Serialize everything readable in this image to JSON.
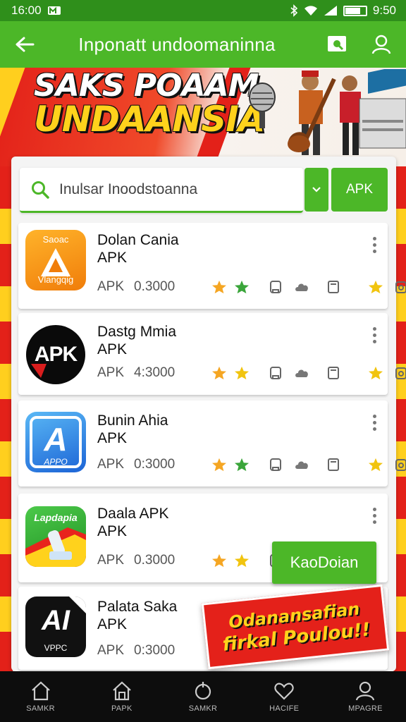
{
  "status_bar": {
    "time": "16:00",
    "right_text": "9:50"
  },
  "app_bar": {
    "title": "Inponatt undoomaninna"
  },
  "banner": {
    "line1": "SAKS POAAM",
    "line2": "UNDAANSIA"
  },
  "search": {
    "placeholder": "Inulsar Inoodstoanna",
    "apk_button": "APK"
  },
  "apps": [
    {
      "icon_text_top": "Saoac",
      "icon_text_bottom": "Vlangqig",
      "name": "Dolan Cania",
      "type": "APK",
      "label": "APK",
      "size": "0.3000",
      "icon_colors": [
        "#ffa21c",
        "#f07d0a"
      ]
    },
    {
      "icon_text_top": "APK",
      "icon_text_bottom": "",
      "name": "Dastg Mmia",
      "type": "APK",
      "label": "APK",
      "size": "4:3000",
      "icon_colors": [
        "#0a0a0a",
        "#0a0a0a"
      ]
    },
    {
      "icon_text_top": "A",
      "icon_text_bottom": "APPO",
      "name": "Bunin Ahia",
      "type": "APK",
      "label": "APK",
      "size": "0:3000",
      "icon_colors": [
        "#46a7f2",
        "#1c64d6"
      ]
    },
    {
      "icon_text_top": "Lapdapia",
      "icon_text_bottom": "",
      "name": "Daala APK",
      "type": "APK",
      "label": "APK",
      "size": "0.3000",
      "icon_colors": [
        "#3db83a",
        "#1f8f22"
      ]
    },
    {
      "icon_text_top": "AI",
      "icon_text_bottom": "VPPC",
      "name": "Palata Saka",
      "type": "APK",
      "label": "APK",
      "size": "0:3000",
      "icon_colors": [
        "#111111",
        "#111111"
      ]
    }
  ],
  "download_button": "KaoDoian",
  "promo": {
    "line1": "Odanansafian",
    "line2": "firkal Poulou!!"
  },
  "bottom_nav": [
    {
      "label": "SAMKR",
      "icon": "home-icon"
    },
    {
      "label": "PAPK",
      "icon": "store-icon"
    },
    {
      "label": "SAMKR",
      "icon": "search-icon"
    },
    {
      "label": "HACIFE",
      "icon": "heart-icon"
    },
    {
      "label": "MPAGRE",
      "icon": "profile-icon"
    }
  ]
}
